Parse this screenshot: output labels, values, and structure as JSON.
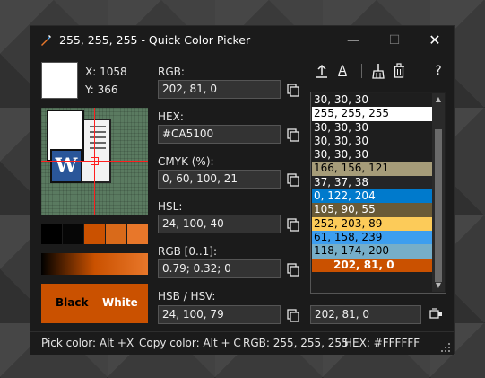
{
  "window": {
    "title": "255, 255, 255 - Quick Color Picker",
    "controls": {
      "minimize": "—",
      "maximize": "☐",
      "close": "✕"
    }
  },
  "picker": {
    "current_color": "#FFFFFF",
    "x_label": "X: 1058",
    "y_label": "Y: 366"
  },
  "shades": [
    "#000000",
    "#060606",
    "#CA5100",
    "#D96A1A",
    "#E8772A"
  ],
  "contrast": {
    "background": "#CA5100",
    "black_label": "Black",
    "white_label": "White"
  },
  "fields": {
    "rgb": {
      "label": "RGB:",
      "value": "202, 81, 0"
    },
    "hex": {
      "label": "HEX:",
      "value": "#CA5100"
    },
    "cmyk": {
      "label": "CMYK (%):",
      "value": "0, 60, 100, 21"
    },
    "hsl": {
      "label": "HSL:",
      "value": "24, 100, 40"
    },
    "rgb01": {
      "label": "RGB [0..1]:",
      "value": "0.79; 0.32; 0"
    },
    "hsb": {
      "label": "HSB / HSV:",
      "value": "24, 100, 79"
    }
  },
  "toolbar": {
    "export_icon": "upload-icon",
    "font_label": "A",
    "clear_icon": "broom-icon",
    "delete_icon": "trash-icon",
    "help_label": "?"
  },
  "history": {
    "items": [
      {
        "text": "30, 30, 30",
        "bg": "#1e1e1e",
        "fg": "#ffffff"
      },
      {
        "text": "255, 255, 255",
        "bg": "#ffffff",
        "fg": "#000000"
      },
      {
        "text": "30, 30, 30",
        "bg": "#1e1e1e",
        "fg": "#ffffff"
      },
      {
        "text": "30, 30, 30",
        "bg": "#1e1e1e",
        "fg": "#ffffff"
      },
      {
        "text": "30, 30, 30",
        "bg": "#1e1e1e",
        "fg": "#ffffff"
      },
      {
        "text": "166, 156, 121",
        "bg": "#a69c79",
        "fg": "#000000"
      },
      {
        "text": "37, 37, 38",
        "bg": "#252526",
        "fg": "#ffffff"
      },
      {
        "text": "0, 122, 204",
        "bg": "#007acc",
        "fg": "#ffffff"
      },
      {
        "text": "105, 90, 55",
        "bg": "#695a37",
        "fg": "#ffffff"
      },
      {
        "text": "252, 203, 89",
        "bg": "#fccb59",
        "fg": "#000000"
      },
      {
        "text": "61, 158, 239",
        "bg": "#3d9eef",
        "fg": "#000000"
      },
      {
        "text": "118, 174, 200",
        "bg": "#76aec8",
        "fg": "#000000"
      },
      {
        "text": "202, 81, 0",
        "bg": "#ca5100",
        "fg": "#ffffff",
        "selected": true
      }
    ],
    "selected_value": "202, 81, 0"
  },
  "status": {
    "pick": "Pick color: Alt +X",
    "copy": "Copy color: Alt + C",
    "rgb": "RGB: 255, 255, 255",
    "hex": "HEX: #FFFFFF"
  }
}
